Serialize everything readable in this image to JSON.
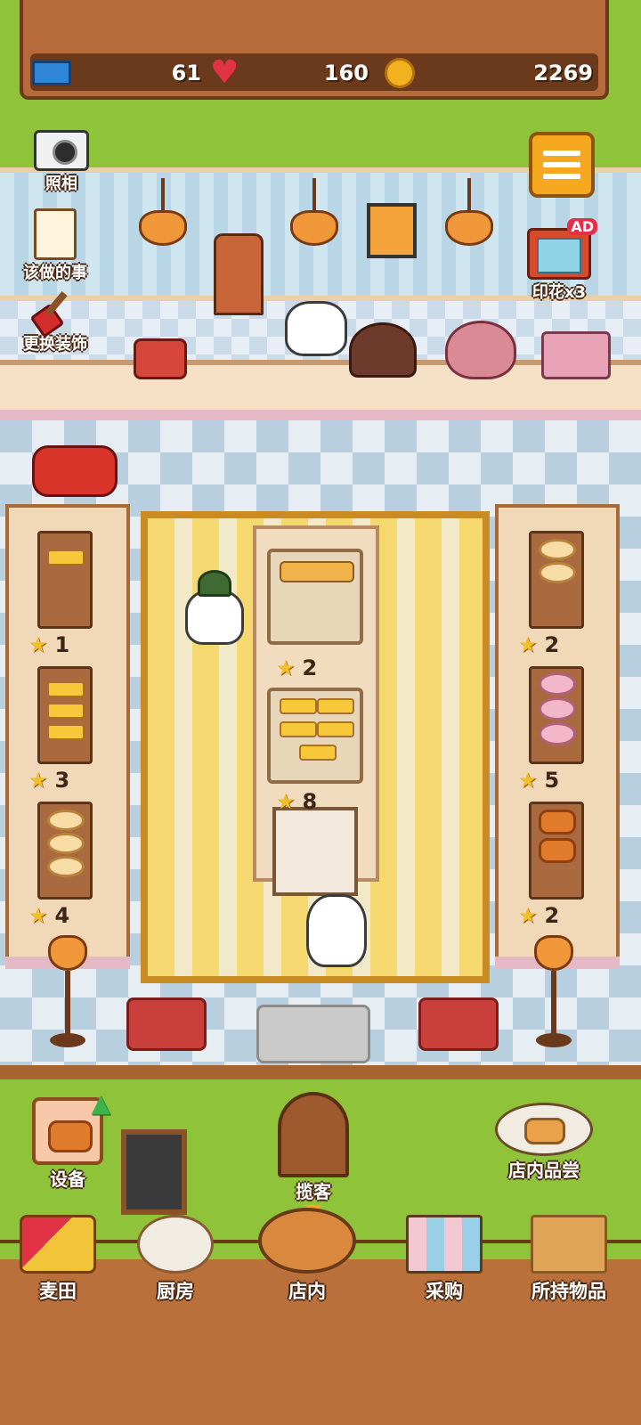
{
  "resources": {
    "tickets": "61",
    "hearts": "160",
    "coins": "2269"
  },
  "side_buttons": {
    "camera": "照相",
    "todo": "该做的事",
    "decorate": "更换装饰",
    "stamps": "印花x3",
    "stamps_badge": "AD"
  },
  "shelf_ratings": {
    "left": [
      "1",
      "3",
      "4"
    ],
    "center": [
      "2",
      "8"
    ],
    "right": [
      "2",
      "5",
      "2"
    ]
  },
  "actions": {
    "equipment": "设备",
    "invite": "揽客",
    "tasting": "店内品尝"
  },
  "nav": [
    {
      "label": "麦田",
      "icon": "wheat-field-icon"
    },
    {
      "label": "厨房",
      "icon": "kitchen-icon"
    },
    {
      "label": "店内",
      "icon": "store-interior-icon"
    },
    {
      "label": "采购",
      "icon": "shopping-icon"
    },
    {
      "label": "所持物品",
      "icon": "inventory-box-icon"
    }
  ],
  "colors": {
    "grass": "#8fc33a",
    "wood": "#b86b3a",
    "menu_button": "#f6a91e",
    "star": "#f4c02a"
  }
}
